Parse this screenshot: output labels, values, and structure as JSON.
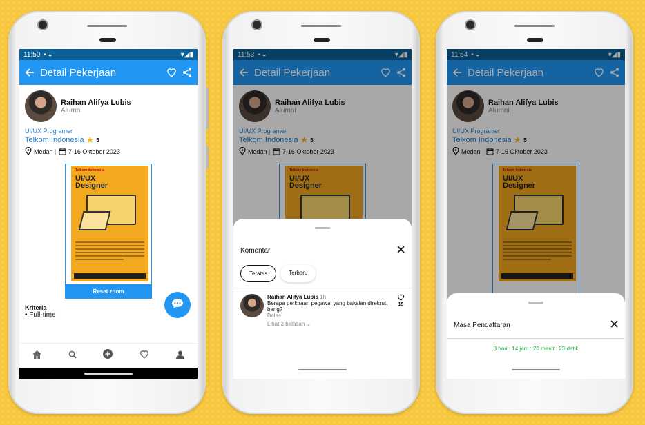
{
  "status": {
    "times": [
      "11:50",
      "11:53",
      "11:54"
    ]
  },
  "appbar": {
    "title": "Detail Pekerjaan"
  },
  "profile": {
    "name": "Raihan Alifya Lubis",
    "role": "Alumni"
  },
  "job": {
    "position": "UI/UX Programer",
    "company": "Telkom Indonesia",
    "rating": "5",
    "location": "Medan",
    "date": "7-16 Oktober 2023"
  },
  "poster": {
    "brand": "Telkom Indonesia",
    "headline_1": "UI/UX",
    "headline_2": "Designer"
  },
  "reset_zoom_label": "Reset zoom",
  "criteria": {
    "title": "Kriteria",
    "item": "• Full-time"
  },
  "nav_icons": [
    "home-icon",
    "search-icon",
    "add-icon",
    "heart-icon",
    "profile-icon"
  ],
  "comments_sheet": {
    "title": "Komentar",
    "tab_top": "Teratas",
    "tab_new": "Terbaru",
    "comment": {
      "author": "Raihan Alifya Lubis",
      "time": "1h",
      "text": "Berapa perkiraan pegawai yang bakalan direkrut, bang?",
      "reply": "Balas",
      "view_replies": "Lihat 3 balasan",
      "likes": "15"
    }
  },
  "registration_sheet": {
    "title": "Masa Pendaftaran",
    "countdown": "8 hari : 14 jam : 20 menit : 23 detik"
  },
  "colors": {
    "primary": "#2196f3",
    "status_bar": "#0c6098",
    "countdown": "#1ea33c",
    "background": "#f7c73e"
  }
}
